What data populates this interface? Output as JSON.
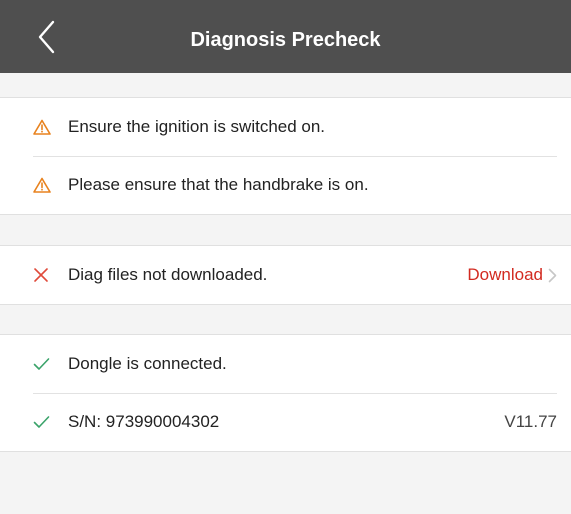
{
  "header": {
    "title": "Diagnosis Precheck",
    "back_icon": "chevron-left-icon"
  },
  "warnings": [
    {
      "icon": "warning-triangle-icon",
      "text": "Ensure the ignition is switched on."
    },
    {
      "icon": "warning-triangle-icon",
      "text": "Please ensure that the handbrake is on."
    }
  ],
  "files": {
    "icon": "cross-icon",
    "text": "Diag files not downloaded.",
    "action_label": "Download",
    "action_icon": "chevron-right-icon"
  },
  "device": {
    "dongle": {
      "icon": "check-icon",
      "text": "Dongle is connected."
    },
    "serial": {
      "icon": "check-icon",
      "text": "S/N: 973990004302",
      "version": "V11.77"
    }
  },
  "colors": {
    "header_bg": "#4f4f4f",
    "warning": "#e8821e",
    "error": "#e04a3a",
    "success": "#3aa36a",
    "link": "#d22a20",
    "page_bg": "#f4f4f4"
  }
}
